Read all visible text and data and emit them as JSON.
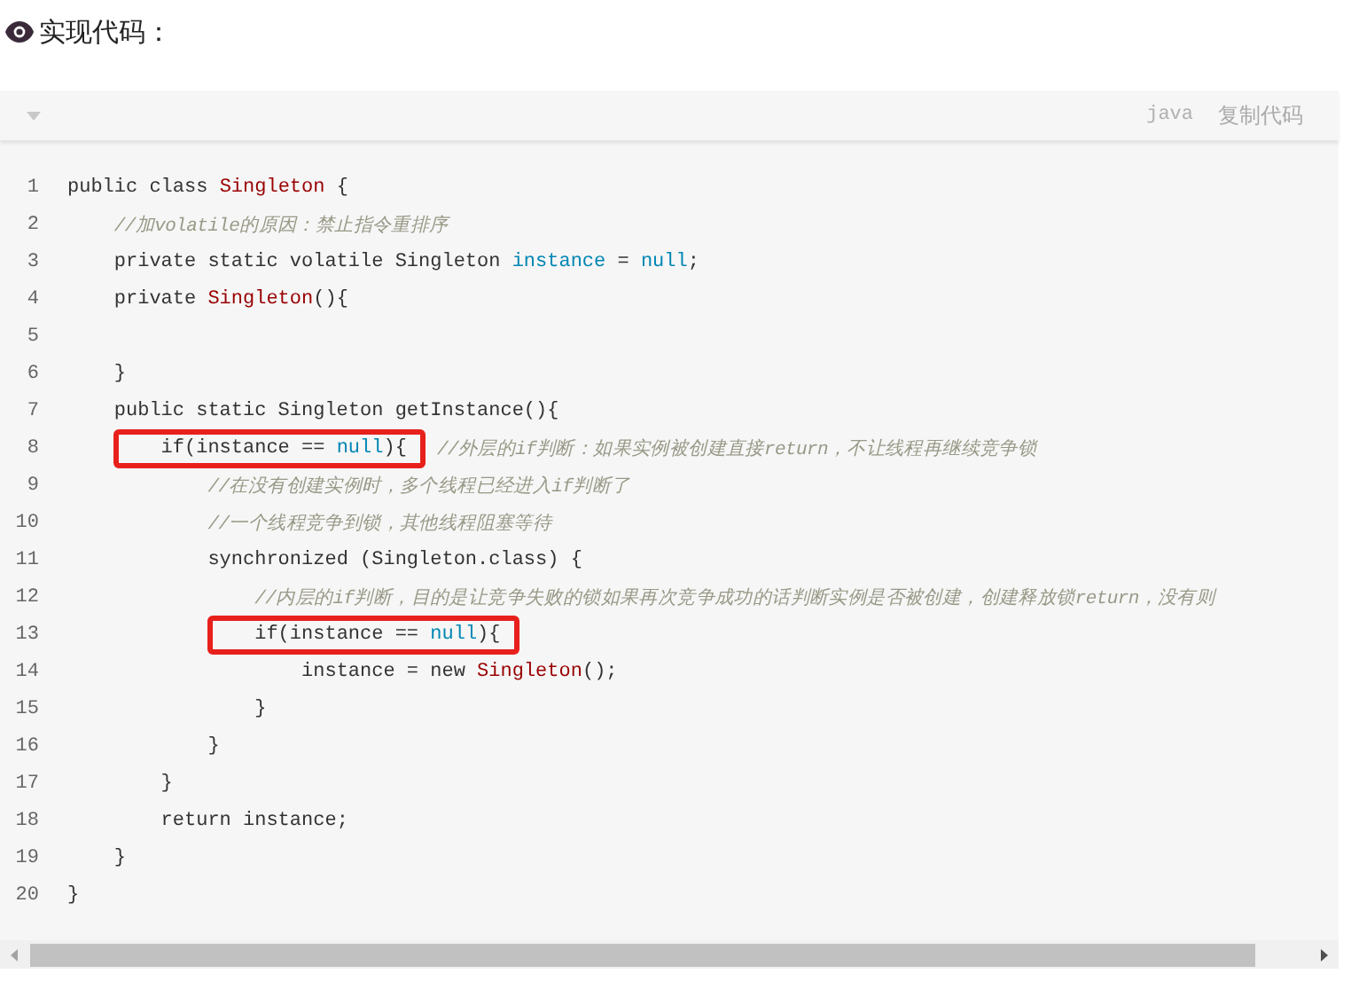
{
  "heading": {
    "text": "实现代码："
  },
  "code_block": {
    "language": "java",
    "copy_label": "复制代码",
    "lines": [
      {
        "number": "1",
        "tokens": [
          {
            "kind": "plain",
            "text": "public class "
          },
          {
            "kind": "type",
            "text": "Singleton"
          },
          {
            "kind": "plain",
            "text": " {"
          }
        ],
        "children": [
          {
            "number": "2",
            "tokens": [
              {
                "kind": "comment",
                "text": "//加volatile的原因：禁止指令重排序"
              }
            ]
          },
          {
            "number": "3",
            "tokens": [
              {
                "kind": "plain",
                "text": "private static volatile Singleton "
              },
              {
                "kind": "literal",
                "text": "instance"
              },
              {
                "kind": "plain",
                "text": " = "
              },
              {
                "kind": "literal",
                "text": "null"
              },
              {
                "kind": "plain",
                "text": ";"
              }
            ]
          },
          {
            "number": "4",
            "tokens": [
              {
                "kind": "plain",
                "text": "private "
              },
              {
                "kind": "type",
                "text": "Singleton"
              },
              {
                "kind": "plain",
                "text": "(){"
              }
            ],
            "children": [
              {
                "number": "5"
              }
            ]
          },
          {
            "number": "6",
            "tokens": [
              {
                "kind": "plain",
                "text": "}"
              }
            ]
          },
          {
            "number": "7",
            "tokens": [
              {
                "kind": "plain",
                "text": "public static Singleton getInstance(){"
              }
            ],
            "children": [
              {
                "number": "8",
                "tokens": [
                  {
                    "kind": "box",
                    "children": [
                      {
                        "kind": "plain",
                        "text": "if(instance == "
                      },
                      {
                        "kind": "literal",
                        "text": "null"
                      },
                      {
                        "kind": "plain",
                        "text": "){"
                      }
                    ]
                  },
                  {
                    "kind": "comment",
                    "text": " //外层的if判断：如果实例被创建直接return，不让线程再继续竞争锁"
                  }
                ],
                "children": [
                  {
                    "number": "9",
                    "tokens": [
                      {
                        "kind": "comment",
                        "text": "//在没有创建实例时，多个线程已经进入if判断了"
                      }
                    ]
                  },
                  {
                    "number": "10",
                    "tokens": [
                      {
                        "kind": "comment",
                        "text": "//一个线程竞争到锁，其他线程阻塞等待"
                      }
                    ]
                  },
                  {
                    "number": "11",
                    "tokens": [
                      {
                        "kind": "plain",
                        "text": "synchronized (Singleton.class) {"
                      }
                    ],
                    "children": [
                      {
                        "number": "12",
                        "tokens": [
                          {
                            "kind": "comment",
                            "text": "//内层的if判断，目的是让竞争失败的锁如果再次竞争成功的话判断实例是否被创建，创建释放锁return，没有则"
                          }
                        ]
                      },
                      {
                        "number": "13",
                        "tokens": [
                          {
                            "kind": "box",
                            "children": [
                              {
                                "kind": "plain",
                                "text": "if(instance == "
                              },
                              {
                                "kind": "literal",
                                "text": "null"
                              },
                              {
                                "kind": "plain",
                                "text": "){"
                              }
                            ]
                          }
                        ],
                        "children": [
                          {
                            "number": "14",
                            "tokens": [
                              {
                                "kind": "plain",
                                "text": "instance = new "
                              },
                              {
                                "kind": "type",
                                "text": "Singleton"
                              },
                              {
                                "kind": "plain",
                                "text": "();"
                              }
                            ]
                          }
                        ]
                      },
                      {
                        "number": "15",
                        "tokens": [
                          {
                            "kind": "plain",
                            "text": "}"
                          }
                        ]
                      }
                    ]
                  },
                  {
                    "number": "16",
                    "tokens": [
                      {
                        "kind": "plain",
                        "text": "}"
                      }
                    ]
                  }
                ]
              },
              {
                "number": "17",
                "tokens": [
                  {
                    "kind": "plain",
                    "text": "}"
                  }
                ]
              },
              {
                "number": "18",
                "tokens": [
                  {
                    "kind": "plain",
                    "text": "return instance;"
                  }
                ]
              }
            ]
          },
          {
            "number": "19",
            "tokens": [
              {
                "kind": "plain",
                "text": "}"
              }
            ]
          }
        ]
      },
      {
        "number": "20",
        "tokens": [
          {
            "kind": "plain",
            "text": "}"
          }
        ]
      }
    ]
  }
}
